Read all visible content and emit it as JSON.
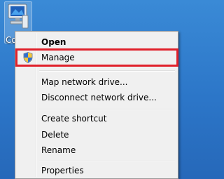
{
  "desktop": {
    "icon_label": "Co",
    "icon_name": "computer-icon"
  },
  "context_menu": {
    "items": [
      {
        "label": "Open",
        "bold": true
      },
      {
        "label": "Manage",
        "icon": "uac-shield-icon",
        "highlighted": true
      },
      {
        "label": "Map network drive..."
      },
      {
        "label": "Disconnect network drive..."
      },
      {
        "label": "Create shortcut"
      },
      {
        "label": "Delete"
      },
      {
        "label": "Rename"
      },
      {
        "label": "Properties"
      }
    ]
  },
  "colors": {
    "highlight_border": "#e0202a",
    "menu_background": "#f0f0f0",
    "desktop_background": "#2c76c8"
  }
}
